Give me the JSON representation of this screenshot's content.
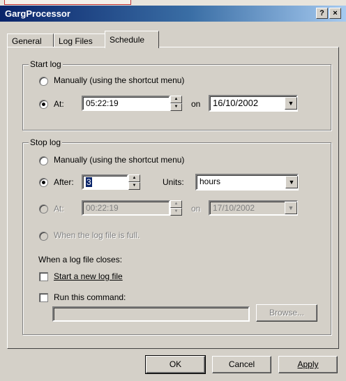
{
  "window": {
    "title": "GargProcessor",
    "help_glyph": "?",
    "close_glyph": "×"
  },
  "tabs": [
    {
      "label": "General"
    },
    {
      "label": "Log Files"
    },
    {
      "label": "Schedule"
    }
  ],
  "start_log": {
    "legend": "Start log",
    "manually_label": "Manually (using the shortcut menu)",
    "at_label": "At:",
    "time_value": "05:22:19",
    "on_label": "on",
    "date_value": "16/10/2002",
    "selected": "at"
  },
  "stop_log": {
    "legend": "Stop log",
    "manually_label": "Manually (using the shortcut menu)",
    "after_label": "After:",
    "after_value": "3",
    "units_label": "Units:",
    "units_value": "hours",
    "at_label": "At:",
    "at_time_value": "00:22:19",
    "on_label": "on",
    "at_date_value": "17/10/2002",
    "when_full_label": "When the log file is full.",
    "closes_label": "When a log file closes:",
    "start_new_label": "Start a new log file",
    "run_command_label": "Run this command:",
    "browse_label": "Browse...",
    "selected": "after"
  },
  "footer": {
    "ok_label": "OK",
    "cancel_label": "Cancel",
    "apply_label": "Apply"
  },
  "icons": {
    "spin_up": "▲",
    "spin_down": "▼",
    "dropdown": "▼"
  },
  "colors": {
    "titlebar_start": "#0a246a",
    "titlebar_end": "#a6caf0",
    "face": "#d4d0c8"
  }
}
